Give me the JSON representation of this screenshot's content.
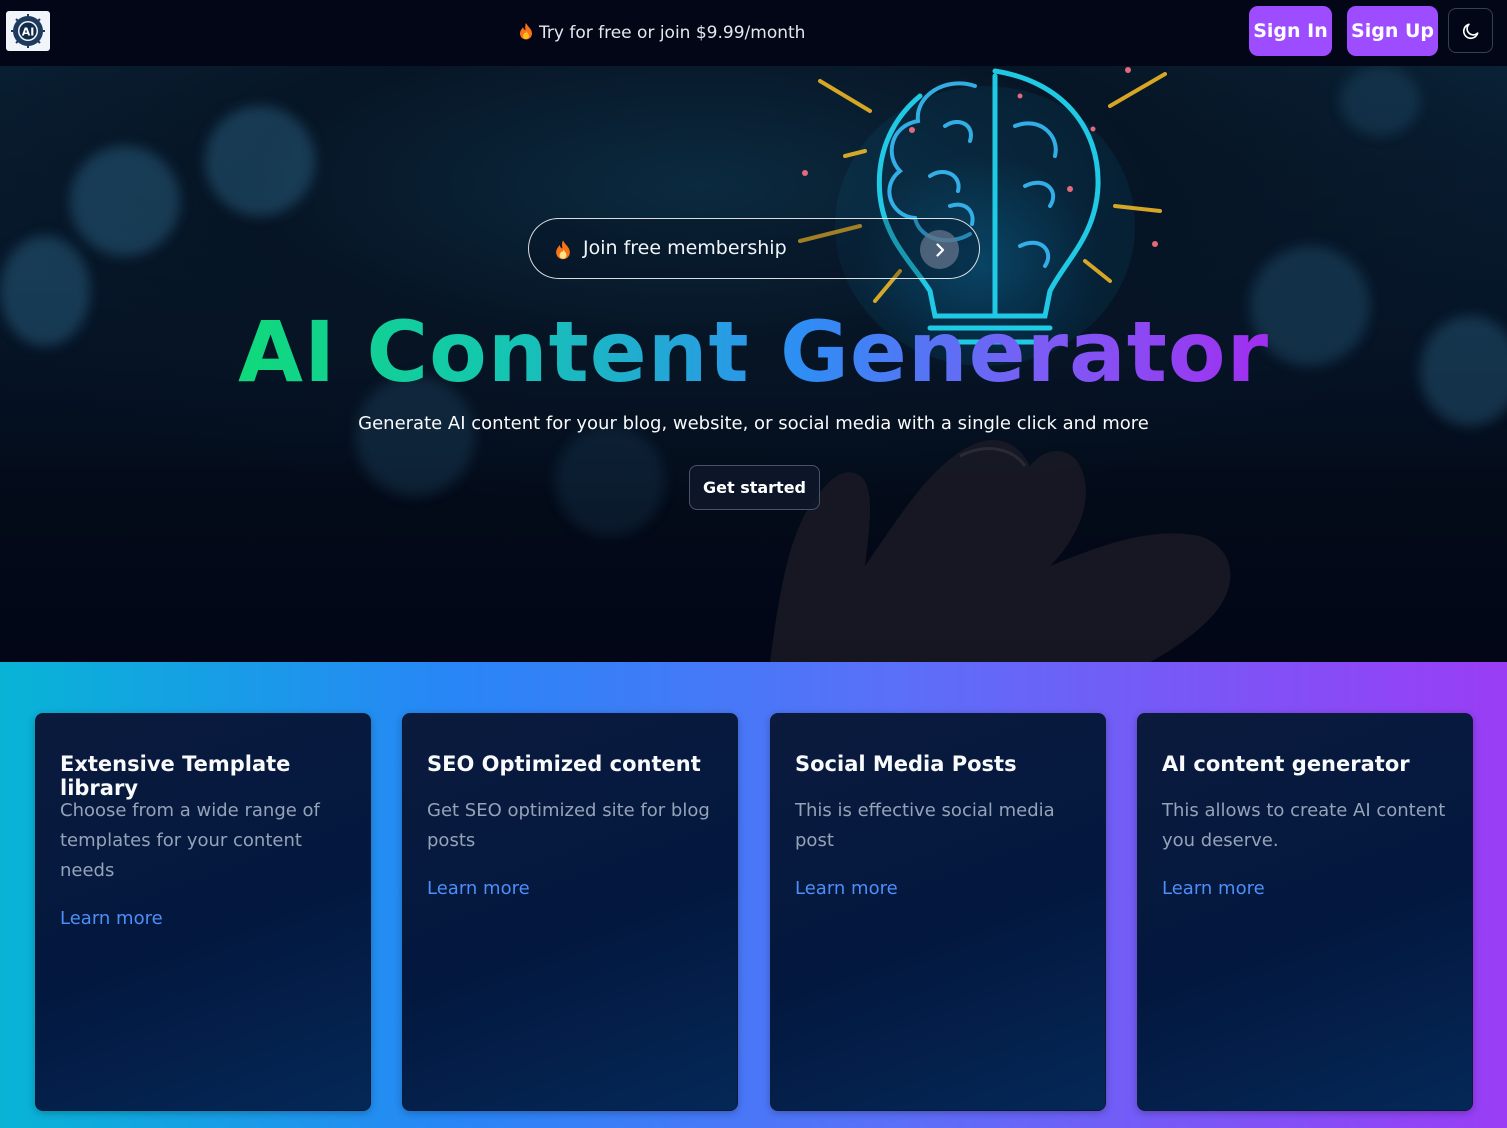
{
  "header": {
    "logo_text": "AI",
    "promo_text": "Try for free or join $9.99/month",
    "sign_in_label": "Sign In",
    "sign_up_label": "Sign Up"
  },
  "hero": {
    "membership_pill_label": "Join free membership",
    "title": "AI Content Generator",
    "subtitle": "Generate AI content for your blog, website, or social media with a single click and more",
    "cta_label": "Get started"
  },
  "features": {
    "cards": [
      {
        "title": "Extensive Template library",
        "description": "Choose from a wide range of templates for your content needs",
        "link": "Learn more"
      },
      {
        "title": "SEO Optimized content",
        "description": "Get SEO optimized site for blog posts",
        "link": "Learn more"
      },
      {
        "title": "Social Media Posts",
        "description": "This is effective social media post",
        "link": "Learn more"
      },
      {
        "title": "AI content generator",
        "description": "This allows to create AI content you deserve.",
        "link": "Learn more"
      }
    ]
  },
  "colors": {
    "accent_purple": "#9d4dff",
    "link_blue": "#4d8ef8",
    "title_gradient_start": "#10d97a",
    "title_gradient_end": "#a12ef0"
  },
  "icons": [
    "flame-icon",
    "chevron-right-icon",
    "moon-icon",
    "ai-logo-icon"
  ]
}
